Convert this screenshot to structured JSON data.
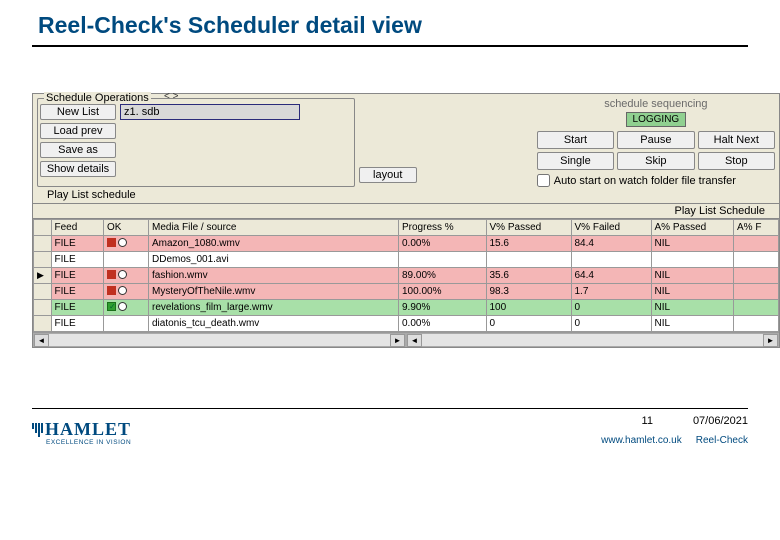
{
  "title": "Reel-Check's Scheduler detail view",
  "schedule_ops": {
    "legend": "Schedule Operations",
    "angles": "< >",
    "new_list": "New List",
    "filename": "z1. sdb",
    "load_prev": "Load prev",
    "save_as": "Save as",
    "show_details": "Show details",
    "layout": "layout"
  },
  "seq": {
    "title": "schedule sequencing",
    "logging": "LOGGING",
    "start": "Start",
    "pause": "Pause",
    "halt_next": "Halt Next",
    "single": "Single",
    "skip": "Skip",
    "stop": "Stop",
    "auto_label": "Auto start on watch folder file transfer"
  },
  "playlist": {
    "tab": "Play List schedule",
    "heading": "Play List Schedule",
    "cols": {
      "feed": "Feed",
      "ok": "OK",
      "media": "Media File / source",
      "progress": "Progress %",
      "vpassed": "V% Passed",
      "vfailed": "V% Failed",
      "apassed": "A% Passed",
      "ax": "A% F"
    },
    "rows": [
      {
        "feed": "FILE",
        "ok": "red",
        "media": "Amazon_1080.wmv",
        "progress": "0.00%",
        "vp": "15.6",
        "vf": "84.4",
        "ap": "NIL",
        "cls": "pink"
      },
      {
        "feed": "FILE",
        "ok": "",
        "media": "DDemos_001.avi",
        "progress": "",
        "vp": "",
        "vf": "",
        "ap": "",
        "cls": ""
      },
      {
        "feed": "FILE",
        "ok": "red",
        "media": "fashion.wmv",
        "progress": "89.00%",
        "vp": "35.6",
        "vf": "64.4",
        "ap": "NIL",
        "cls": "pink",
        "sel": true
      },
      {
        "feed": "FILE",
        "ok": "red",
        "media": "MysteryOfTheNile.wmv",
        "progress": "100.00%",
        "vp": "98.3",
        "vf": "1.7",
        "ap": "NIL",
        "cls": "pink"
      },
      {
        "feed": "FILE",
        "ok": "green",
        "media": "revelations_film_large.wmv",
        "progress": "9.90%",
        "vp": "100",
        "vf": "0",
        "ap": "NIL",
        "cls": "green"
      },
      {
        "feed": "FILE",
        "ok": "",
        "media": "diatonis_tcu_death.wmv",
        "progress": "0.00%",
        "vp": "0",
        "vf": "0",
        "ap": "NIL",
        "cls": ""
      }
    ]
  },
  "footer": {
    "logo": "HAMLET",
    "tagline": "EXCELLENCE IN VISION",
    "page": "11",
    "date": "07/06/2021",
    "url": "www.hamlet.co.uk",
    "product": "Reel-Check"
  }
}
